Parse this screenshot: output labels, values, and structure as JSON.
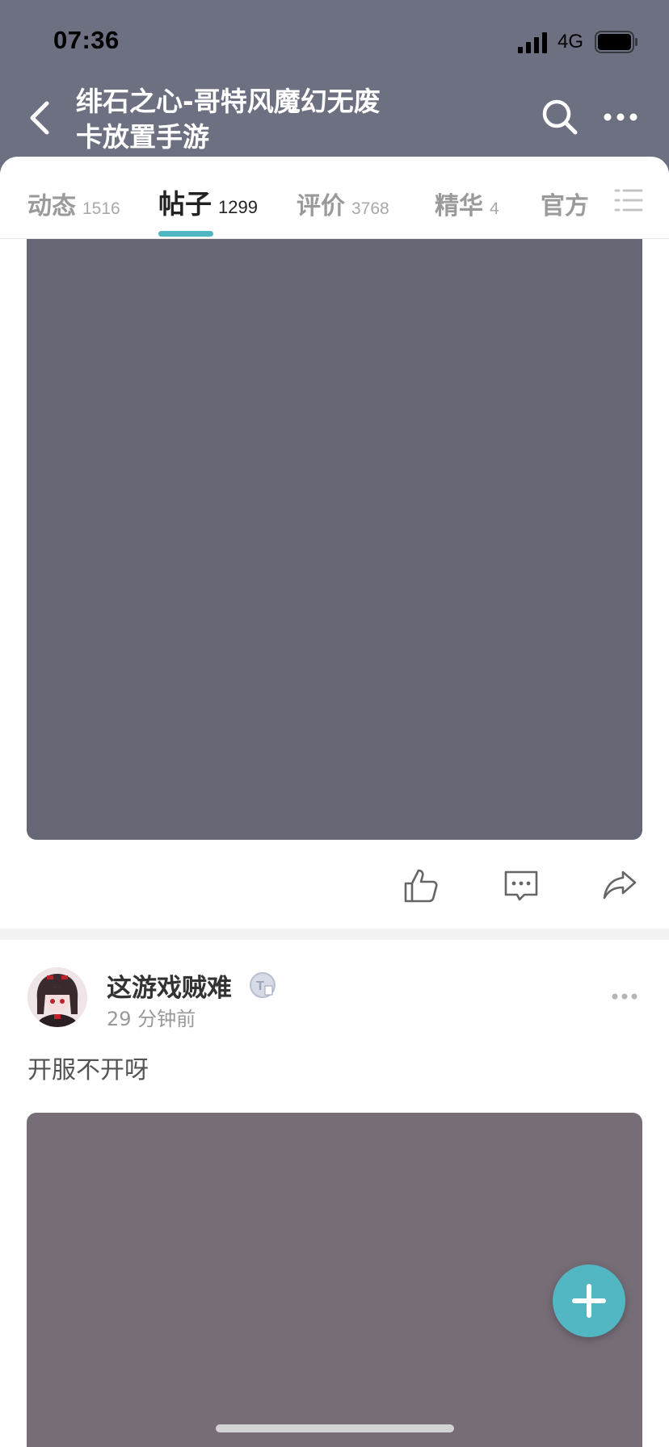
{
  "status_bar": {
    "time": "07:36",
    "network": "4G"
  },
  "header": {
    "title_line1": "绯石之心-哥特风魔幻无废",
    "title_line2": "卡放置手游",
    "back_icon": "chevron-left-icon",
    "search_icon": "search-icon",
    "more_icon": "more-horizontal-icon"
  },
  "tabs": [
    {
      "label": "动态",
      "count": "1516",
      "active": false
    },
    {
      "label": "帖子",
      "count": "1299",
      "active": true
    },
    {
      "label": "评价",
      "count": "3768",
      "active": false
    },
    {
      "label": "精华",
      "count": "4",
      "active": false
    },
    {
      "label": "官方",
      "count": "",
      "active": false
    }
  ],
  "actions": {
    "like_icon": "thumbs-up-icon",
    "comment_icon": "comment-icon",
    "share_icon": "share-icon"
  },
  "post": {
    "username": "这游戏贼难",
    "time": "29 分钟前",
    "text": "开服不开呀"
  },
  "colors": {
    "header_bg": "#6c7080",
    "accent": "#53b6c3",
    "image_top": "#656874",
    "image_bottom": "#776d77"
  }
}
